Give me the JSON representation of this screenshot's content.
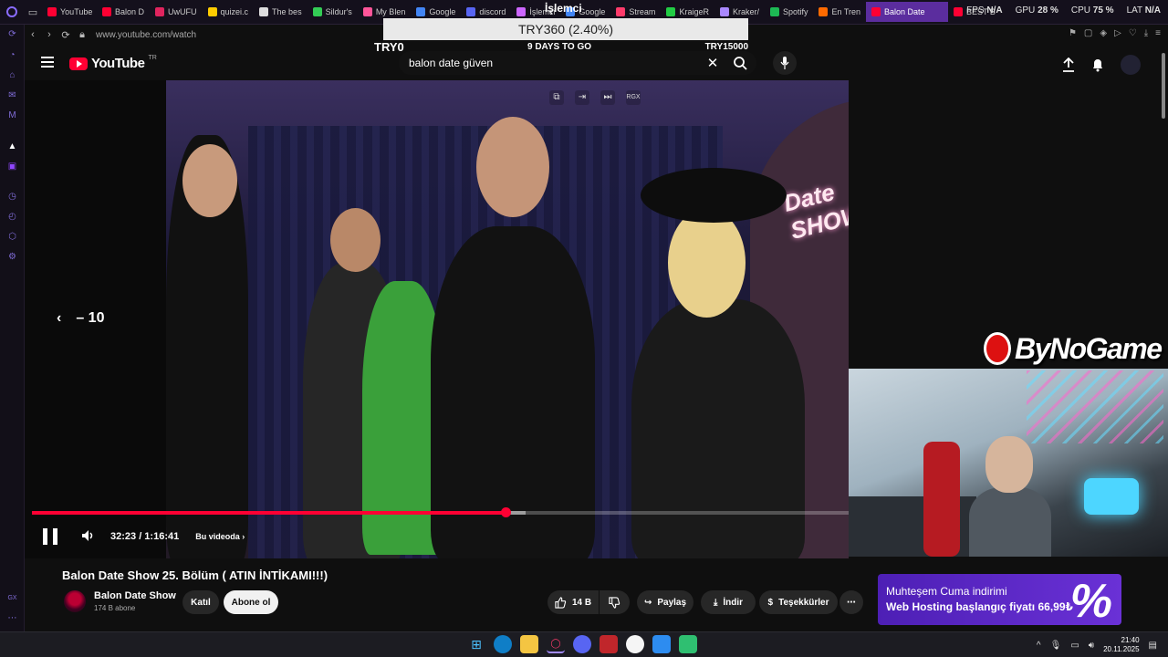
{
  "browser": {
    "tabs": [
      {
        "label": "YouTube",
        "color": "#ff0033"
      },
      {
        "label": "Balon D",
        "color": "#ff0033"
      },
      {
        "label": "UwUFU",
        "color": "#e0245e"
      },
      {
        "label": "quizei.c",
        "color": "#ffcc00"
      },
      {
        "label": "The bes",
        "color": "#dddddd"
      },
      {
        "label": "Sildur's",
        "color": "#33cc55"
      },
      {
        "label": "My Blen",
        "color": "#ff5599"
      },
      {
        "label": "Google",
        "color": "#4285f4"
      },
      {
        "label": "discord",
        "color": "#5865f2"
      },
      {
        "label": "İşlemci",
        "color": "#cc66ff"
      },
      {
        "label": "Google",
        "color": "#4285f4"
      },
      {
        "label": "Stream",
        "color": "#ff3b6b"
      },
      {
        "label": "KraigeR",
        "color": "#22cc44"
      },
      {
        "label": "Kraker/",
        "color": "#aa88ff"
      },
      {
        "label": "Spotify",
        "color": "#1db954"
      },
      {
        "label": "En Tren",
        "color": "#ff6a00"
      },
      {
        "label": "Balon Date",
        "color": "#ff0033",
        "active": true
      },
      {
        "label": "BEST B",
        "color": "#ff0033"
      }
    ],
    "url": "www.youtube.com/watch",
    "stats": {
      "fps_label": "FPS",
      "fps_value": "N/A",
      "gpu_label": "GPU",
      "gpu_value": "28 %",
      "cpu_label": "CPU",
      "cpu_value": "75 %",
      "lat_label": "LAT",
      "lat_value": "N/A"
    }
  },
  "donation": {
    "title": "İşlemci",
    "amount": "TRY360 (2.40%)",
    "progress_fraction": 0.024,
    "start": "TRY0",
    "days": "9 DAYS TO GO",
    "goal": "TRY15000"
  },
  "youtube": {
    "logo": "YouTube",
    "region": "TR",
    "search": {
      "value": "balon date güven"
    }
  },
  "player": {
    "seek_label": "– 10",
    "current_time": "32:23",
    "duration": "1:16:41",
    "time_display": "32:23 / 1:16:41",
    "chapter_label": "Bu videoda",
    "played_fraction": 0.58,
    "buffered_fraction": 0.605,
    "overlay_icons": [
      "popout-icon",
      "exit-icon",
      "skip-icon",
      "RGX"
    ],
    "sign_text": "Date\nSHOW"
  },
  "overlay": {
    "sponsor": "ByNoGame"
  },
  "video": {
    "title": "Balon Date Show 25. Bölüm ( ATIN İNTİKAMI!!!)",
    "channel": "Balon Date Show",
    "subscribers": "174 B abone",
    "join_label": "Katıl",
    "subscribe_label": "Abone ol",
    "likes": "14 B",
    "share_label": "Paylaş",
    "download_label": "İndir",
    "thanks_label": "Teşekkürler"
  },
  "ad": {
    "line1": "Muhteşem Cuma indirimi",
    "line2": "Web Hosting başlangıç fiyatı 66,99₺",
    "symbol": "%"
  },
  "taskbar": {
    "time": "21:40",
    "date": "20.11.2025"
  },
  "sidebar": {
    "bottom_label": "GX"
  }
}
